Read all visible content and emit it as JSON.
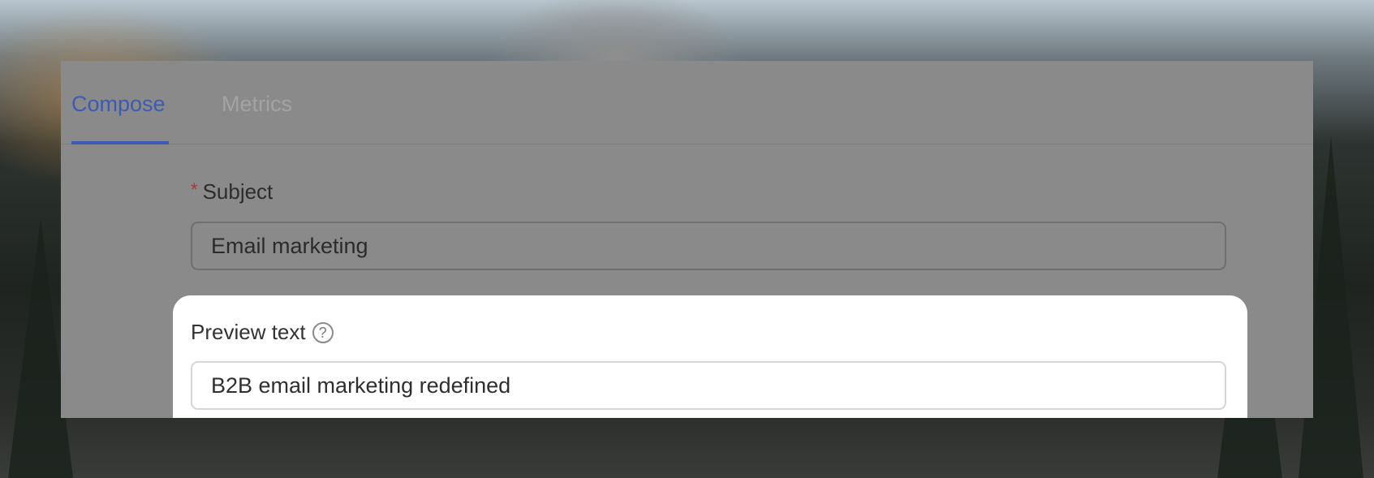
{
  "tabs": [
    {
      "label": "Compose",
      "active": true
    },
    {
      "label": "Metrics",
      "active": false
    }
  ],
  "form": {
    "subject": {
      "required_mark": "*",
      "label": "Subject",
      "value": "Email marketing"
    },
    "preview": {
      "label": "Preview text",
      "help_icon_glyph": "?",
      "value": "B2B email marketing redefined"
    }
  },
  "colors": {
    "accent": "#3c5bb5",
    "required": "#a33a3a"
  }
}
